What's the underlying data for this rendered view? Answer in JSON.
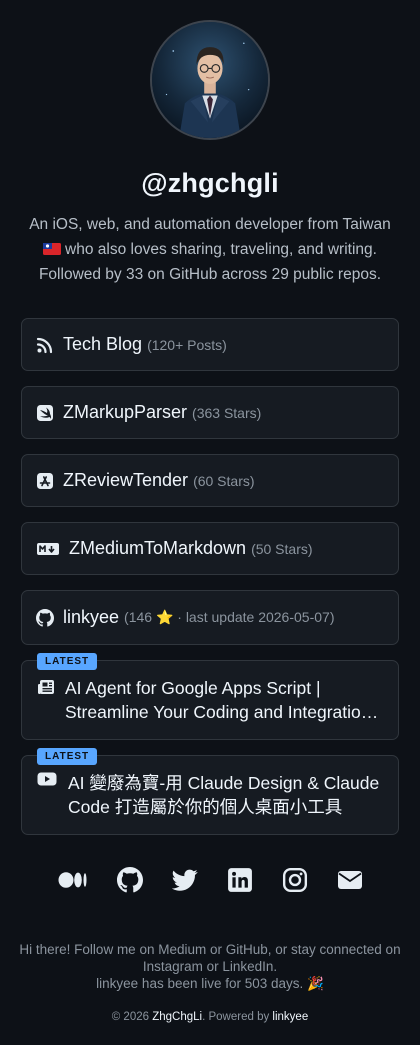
{
  "profile": {
    "handle": "@zhgchgli",
    "bio_line1": "An iOS, web, and automation developer from Taiwan",
    "bio_line2": "who also loves sharing, traveling, and writing.",
    "bio_line3": "Followed by 33 on GitHub across 29 public repos."
  },
  "links": [
    {
      "icon": "rss-icon",
      "title": "Tech Blog",
      "meta": "(120+ Posts)"
    },
    {
      "icon": "swift-icon",
      "title": "ZMarkupParser",
      "meta": "(363 Stars)"
    },
    {
      "icon": "app-store-icon",
      "title": "ZReviewTender",
      "meta": "(60 Stars)"
    },
    {
      "icon": "markdown-icon",
      "title": "ZMediumToMarkdown",
      "meta": "(50 Stars)"
    },
    {
      "icon": "github-icon",
      "title": "linkyee",
      "meta": "(146 ⭐ · last update 2026-05-07)"
    }
  ],
  "latest": [
    {
      "badge": "LATEST",
      "icon": "newspaper-icon",
      "title": "AI Agent for Google Apps Script | Streamline Your Coding and Integration Workflows"
    },
    {
      "badge": "LATEST",
      "icon": "youtube-icon",
      "title": "AI 變廢為寶-用 Claude Design & Claude Code 打造屬於你的個人桌面小工具"
    }
  ],
  "socials": [
    "medium-icon",
    "github-icon",
    "twitter-icon",
    "linkedin-icon",
    "instagram-icon",
    "email-icon"
  ],
  "footer": {
    "message": "Hi there! Follow me on Medium or GitHub, or stay connected on Instagram or LinkedIn.",
    "live": "linkyee has been live for 503 days. 🎉",
    "copy_prefix": "© 2026 ",
    "copy_name": "ZhgChgLi",
    "copy_mid": ". Powered by ",
    "copy_powered": "linkyee"
  },
  "colors": {
    "background": "#0d1117",
    "card": "#161b22",
    "border": "#30363d",
    "badge": "#58a6ff"
  }
}
